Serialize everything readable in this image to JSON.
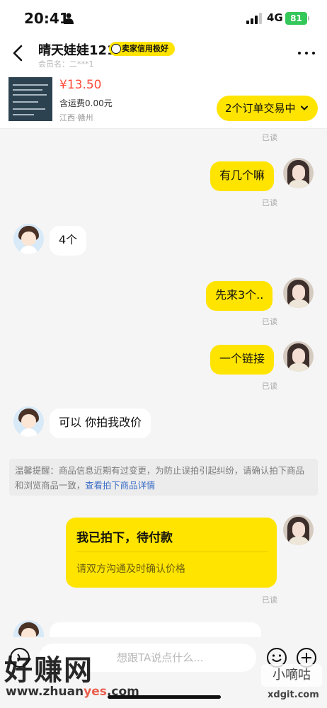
{
  "status_bar": {
    "time": "20:41",
    "network": "4G",
    "battery": "81"
  },
  "header": {
    "name": "晴天娃娃121",
    "credit_badge": "卖家信用极好",
    "member_label": "会员名：二***1"
  },
  "product": {
    "price": "¥13.50",
    "shipping": "含运费0.00元",
    "location": "江西·赣州",
    "orders_button": "2个订单交易中"
  },
  "messages": {
    "top_read": "已读",
    "m1_text": "有几个嘛",
    "m1_read": "已读",
    "m2_text": "4个",
    "m3_text": "先来3个..",
    "m3_read": "已读",
    "m4_text": "一个链接",
    "m4_read": "已读",
    "m5_text": "可以 你拍我改价"
  },
  "notice": {
    "text": "温馨提醒：商品信息近期有过变更，为防止误拍引起纠纷，请确认拍下商品和浏览商品一致，",
    "link": "查看拍下商品详情"
  },
  "order_card": {
    "title": "我已拍下，待付款",
    "subtitle": "请双方沟通及时确认价格",
    "read": "已读"
  },
  "input": {
    "placeholder": "想跟TA说点什么..."
  },
  "watermark": {
    "main": "好赚网",
    "url_prefix": "www.zhuan",
    "url_accent": "yes",
    "url_suffix": ".com",
    "side": "小嘀咕",
    "side_url": "xdgit.com"
  }
}
